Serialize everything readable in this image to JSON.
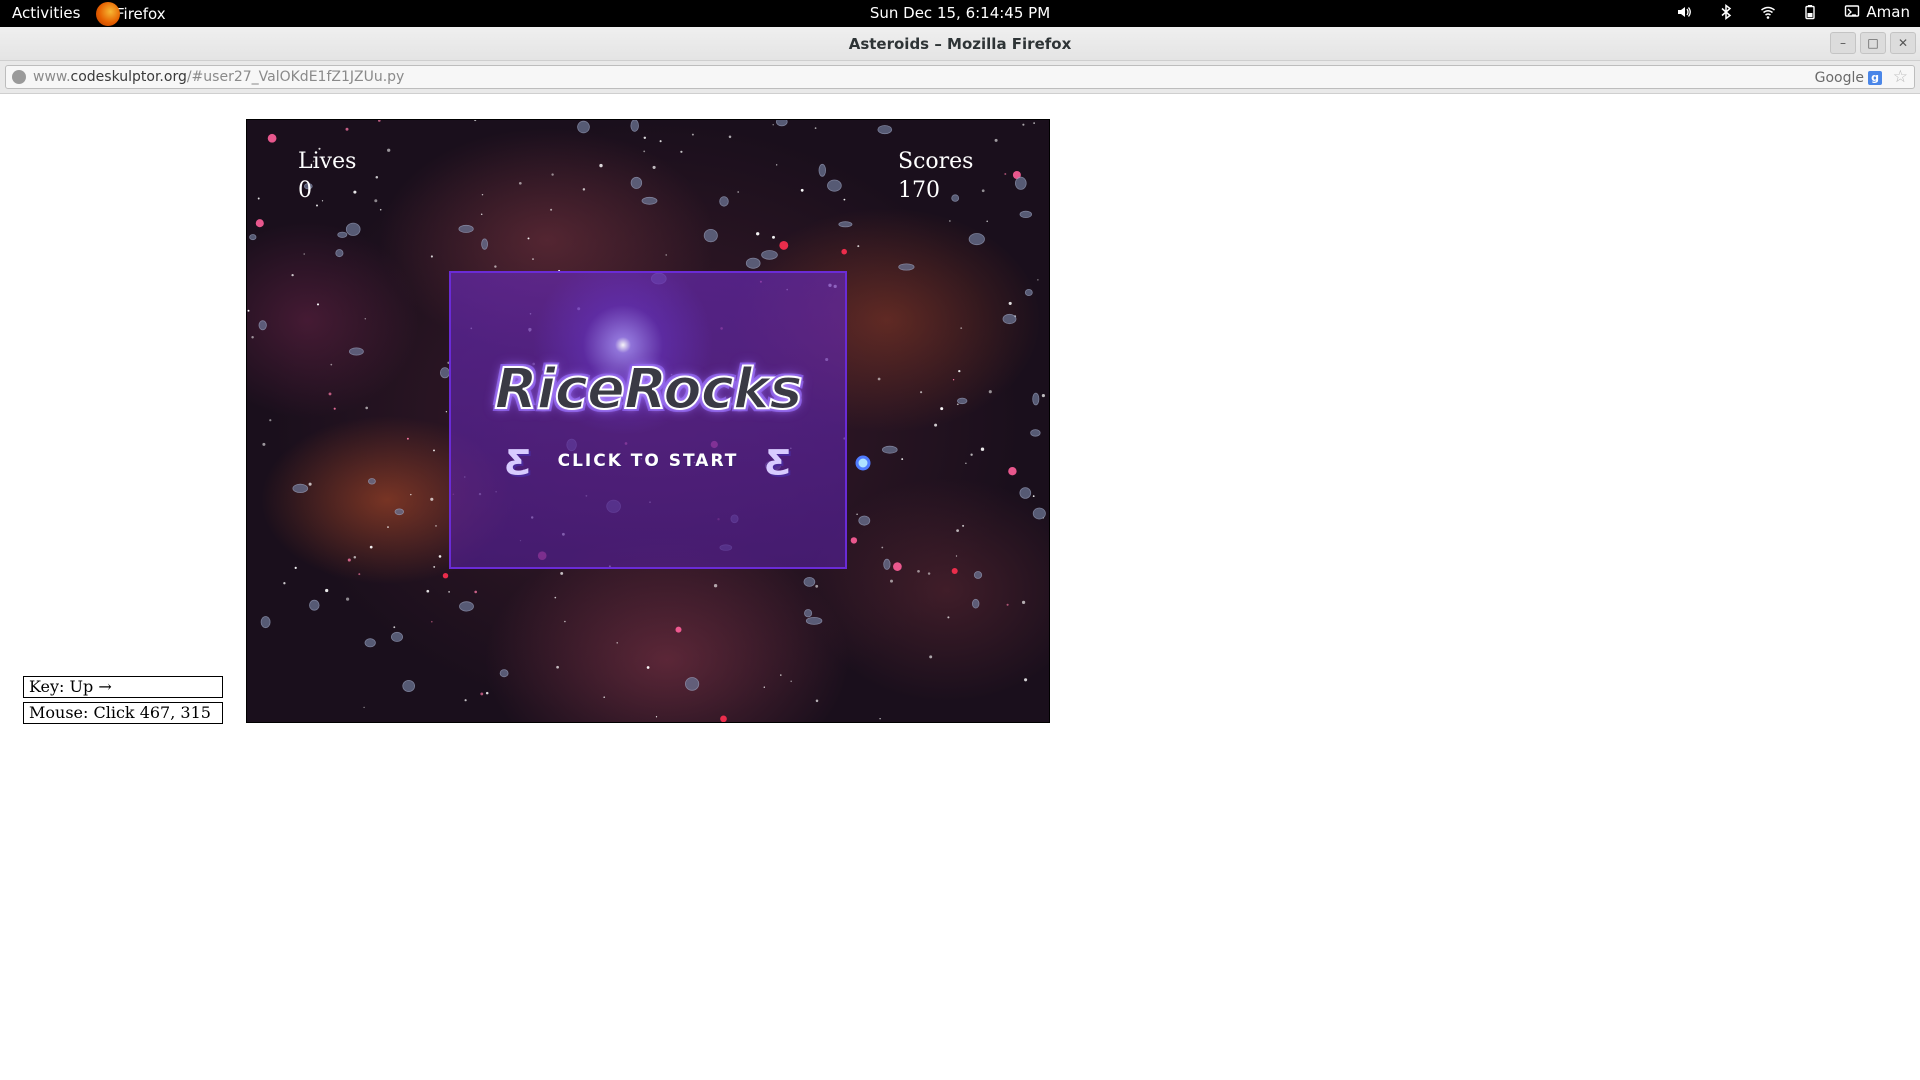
{
  "topbar": {
    "activities": "Activities",
    "app_name": "Firefox",
    "clock": "Sun Dec 15,  6:14:45 PM",
    "user": "Aman",
    "icons": [
      "volume-icon",
      "bluetooth-icon",
      "wifi-icon",
      "battery-icon",
      "user-icon"
    ]
  },
  "window": {
    "title": "Asteroids – Mozilla Firefox",
    "controls": [
      "minimize",
      "maximize",
      "close"
    ]
  },
  "urlbar": {
    "url_prefix": "www.",
    "url_host": "codeskulptor.org",
    "url_path": "/#user27_ValOKdE1fZ1JZUu.py",
    "search_engine": "Google"
  },
  "controls": {
    "key": "Key: Up →",
    "mouse": "Mouse: Click 467, 315"
  },
  "game": {
    "lives_label": "Lives",
    "lives_value": "0",
    "score_label": "Scores",
    "score_value": "170",
    "splash_title": "RiceRocks",
    "splash_cta": "CLICK TO START",
    "accent_color": "#6a2bd6",
    "background_color": "#1a0f1c"
  }
}
